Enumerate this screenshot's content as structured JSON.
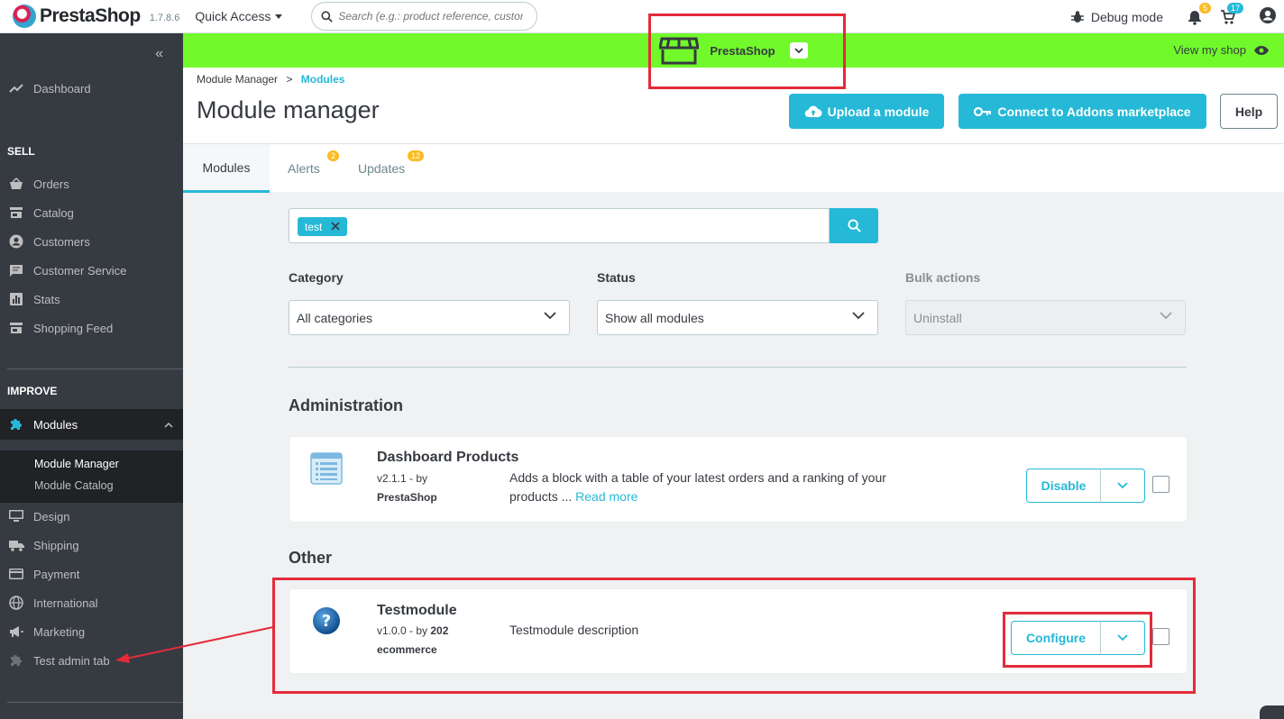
{
  "header": {
    "logo_text": "PrestaShop",
    "version": "1.7.8.6",
    "quick_access": "Quick Access",
    "search_placeholder": "Search (e.g.: product reference, custon",
    "debug_mode": "Debug mode",
    "notifications_count": "5",
    "orders_count": "17"
  },
  "shopbar": {
    "shop_name": "PrestaShop",
    "view_my_shop": "View my shop",
    "color": "#72f92c"
  },
  "sidebar": {
    "dashboard": "Dashboard",
    "sell_section": "SELL",
    "sell_items": [
      "Orders",
      "Catalog",
      "Customers",
      "Customer Service",
      "Stats",
      "Shopping Feed"
    ],
    "improve_section": "IMPROVE",
    "modules": "Modules",
    "module_manager": "Module Manager",
    "module_catalog": "Module Catalog",
    "improve_items": [
      "Design",
      "Shipping",
      "Payment",
      "International",
      "Marketing",
      "Test admin tab"
    ]
  },
  "page": {
    "breadcrumb_parent": "Module Manager",
    "breadcrumb_separator": ">",
    "breadcrumb_current": "Modules",
    "title": "Module manager",
    "upload_button": "Upload a module",
    "connect_button": "Connect to Addons marketplace",
    "help_button": "Help"
  },
  "tabs": [
    {
      "label": "Modules"
    },
    {
      "label": "Alerts",
      "badge": "2"
    },
    {
      "label": "Updates",
      "badge": "12"
    }
  ],
  "filters": {
    "search_tag": "test",
    "category_label": "Category",
    "category_value": "All categories",
    "status_label": "Status",
    "status_value": "Show all modules",
    "bulk_label": "Bulk actions",
    "bulk_value": "Uninstall"
  },
  "sections": [
    {
      "title": "Administration",
      "module": {
        "name": "Dashboard Products",
        "version_by": "v2.1.1 - by",
        "author": "PrestaShop",
        "description_1": "Adds a block with a table of your latest orders and a ranking of your",
        "description_2": "products ...",
        "read_more": "Read more",
        "action": "Disable",
        "icon": "list-document-icon"
      }
    },
    {
      "title": "Other",
      "module": {
        "name": "Testmodule",
        "version_by": "v1.0.0 - by",
        "author_1": "202",
        "author_2": "ecommerce",
        "description": "Testmodule description",
        "action": "Configure",
        "icon": "question-mark-icon"
      }
    }
  ],
  "colors": {
    "accent": "#25b9d7",
    "sidebar": "#363a41",
    "annotation": "#e32b3a"
  }
}
